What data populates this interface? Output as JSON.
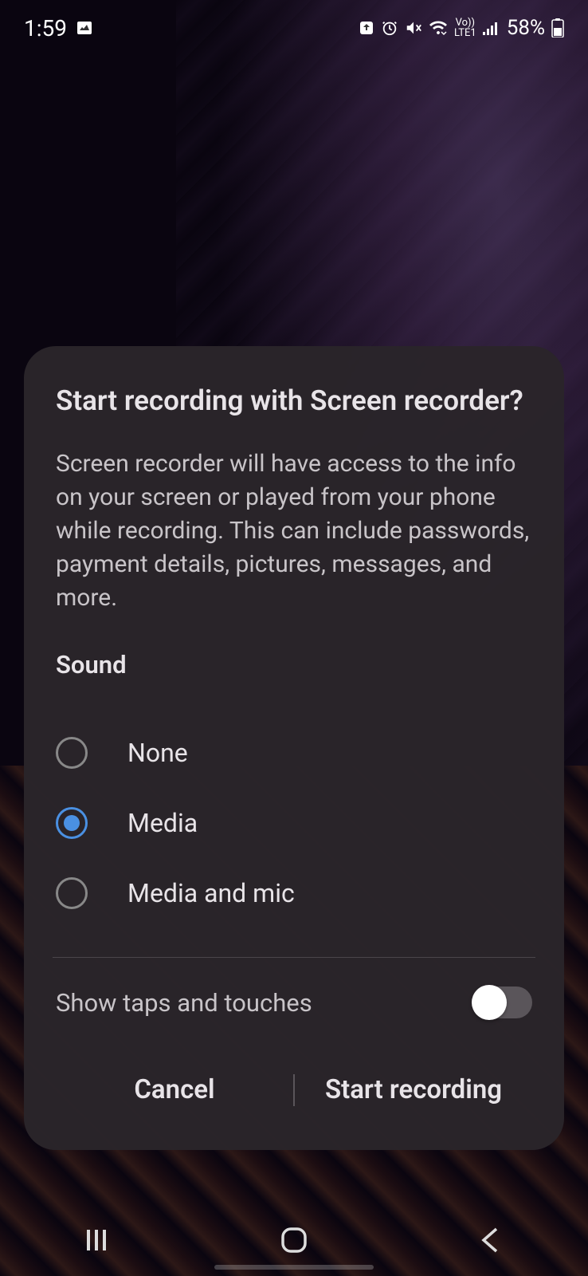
{
  "status": {
    "time": "1:59",
    "battery": "58%",
    "lte_top": "Vo))",
    "lte_bottom": "LTE1"
  },
  "dialog": {
    "title": "Start recording with Screen recorder?",
    "body": "Screen recorder will have access to the info on your screen or played from your phone while recording. This can include passwords, payment details, pictures, messages, and more.",
    "sound_section": "Sound",
    "options": {
      "none": "None",
      "media": "Media",
      "media_mic": "Media and mic"
    },
    "toggle": {
      "label": "Show taps and touches"
    },
    "buttons": {
      "cancel": "Cancel",
      "start": "Start recording"
    }
  }
}
